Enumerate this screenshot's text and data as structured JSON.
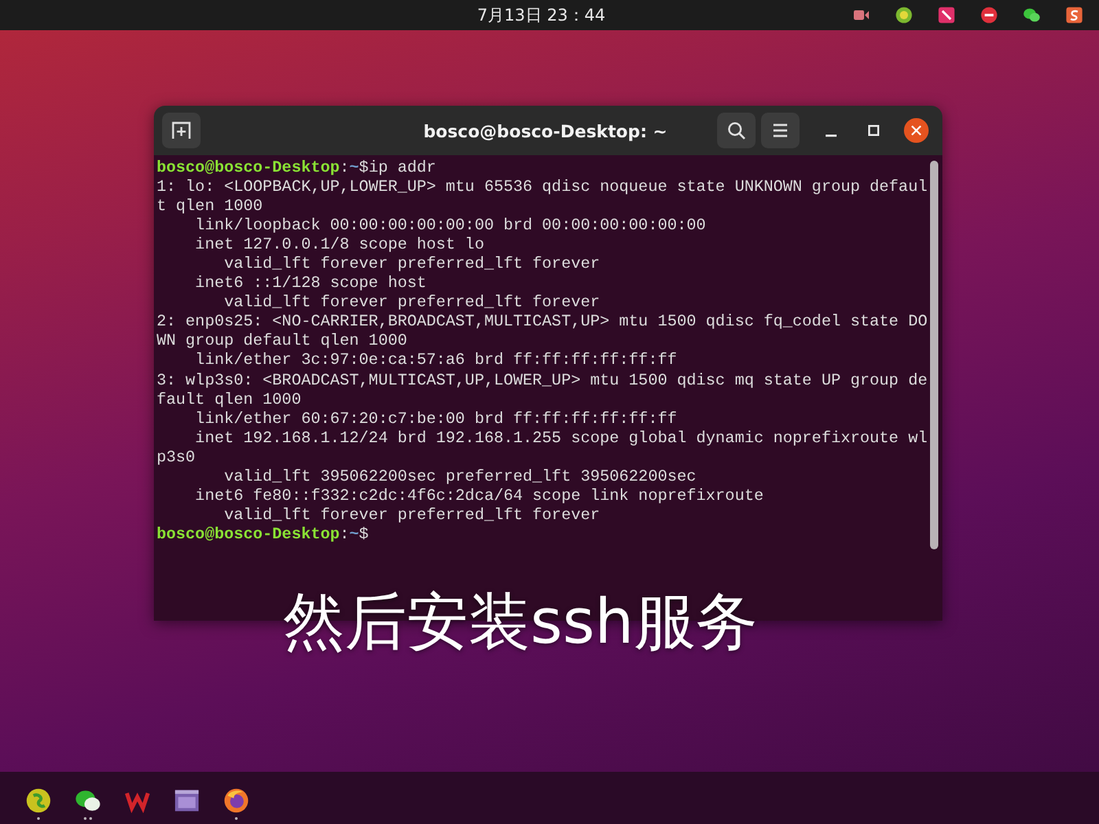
{
  "top_bar": {
    "clock": "7月13日 23：44"
  },
  "terminal": {
    "title": "bosco@bosco-Desktop: ~",
    "lines": [
      {
        "kind": "prompt",
        "user_host": "bosco@bosco-Desktop",
        "separator": ":",
        "path": "~",
        "symbol": "$",
        "command": "ip addr"
      },
      {
        "kind": "output",
        "text": "1: lo: <LOOPBACK,UP,LOWER_UP> mtu 65536 qdisc noqueue state UNKNOWN group defaul"
      },
      {
        "kind": "output",
        "text": "t qlen 1000"
      },
      {
        "kind": "output",
        "text": "    link/loopback 00:00:00:00:00:00 brd 00:00:00:00:00:00"
      },
      {
        "kind": "output",
        "text": "    inet 127.0.0.1/8 scope host lo"
      },
      {
        "kind": "output",
        "text": "       valid_lft forever preferred_lft forever"
      },
      {
        "kind": "output",
        "text": "    inet6 ::1/128 scope host"
      },
      {
        "kind": "output",
        "text": "       valid_lft forever preferred_lft forever"
      },
      {
        "kind": "output",
        "text": "2: enp0s25: <NO-CARRIER,BROADCAST,MULTICAST,UP> mtu 1500 qdisc fq_codel state DO"
      },
      {
        "kind": "output",
        "text": "WN group default qlen 1000"
      },
      {
        "kind": "output",
        "text": "    link/ether 3c:97:0e:ca:57:a6 brd ff:ff:ff:ff:ff:ff"
      },
      {
        "kind": "output",
        "text": "3: wlp3s0: <BROADCAST,MULTICAST,UP,LOWER_UP> mtu 1500 qdisc mq state UP group de"
      },
      {
        "kind": "output",
        "text": "fault qlen 1000"
      },
      {
        "kind": "output",
        "text": "    link/ether 60:67:20:c7:be:00 brd ff:ff:ff:ff:ff:ff"
      },
      {
        "kind": "output",
        "text": "    inet 192.168.1.12/24 brd 192.168.1.255 scope global dynamic noprefixroute wl"
      },
      {
        "kind": "output",
        "text": "p3s0"
      },
      {
        "kind": "output",
        "text": "       valid_lft 395062200sec preferred_lft 395062200sec"
      },
      {
        "kind": "output",
        "text": "    inet6 fe80::f332:c2dc:4f6c:2dca/64 scope link noprefixroute"
      },
      {
        "kind": "output",
        "text": "       valid_lft forever preferred_lft forever"
      },
      {
        "kind": "prompt",
        "user_host": "bosco@bosco-Desktop",
        "separator": ":",
        "path": "~",
        "symbol": "$"
      }
    ]
  },
  "caption": "然后安装ssh服务",
  "dock": {
    "items": [
      {
        "running": true,
        "multi_window": false
      },
      {
        "running": true,
        "multi_window": true
      },
      {
        "running": false,
        "multi_window": false
      },
      {
        "running": false,
        "multi_window": false
      },
      {
        "running": true,
        "multi_window": false
      }
    ]
  }
}
